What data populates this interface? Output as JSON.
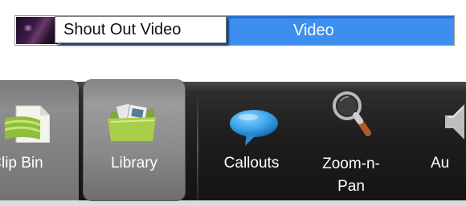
{
  "timeline": {
    "clip_title": "Shout Out Video",
    "track_label": "Video"
  },
  "tabs": [
    {
      "id": "clip-bin",
      "label": "Clip Bin",
      "icon": "clip-bin-icon"
    },
    {
      "id": "library",
      "label": "Library",
      "icon": "library-folder-icon",
      "selected": true
    },
    {
      "id": "callouts",
      "label": "Callouts",
      "icon": "speech-bubble-icon"
    },
    {
      "id": "zoom-n-pan",
      "label": "Zoom-n-\nPan",
      "icon": "magnifier-icon"
    },
    {
      "id": "audio",
      "label": "Au",
      "icon": "speaker-icon"
    }
  ],
  "colors": {
    "track_blue": "#3d8fef",
    "toolbar_dark": "#1e1e1e",
    "tab_selected_gray": "#9c9c9c",
    "callout_blue": "#3aa3e8"
  }
}
